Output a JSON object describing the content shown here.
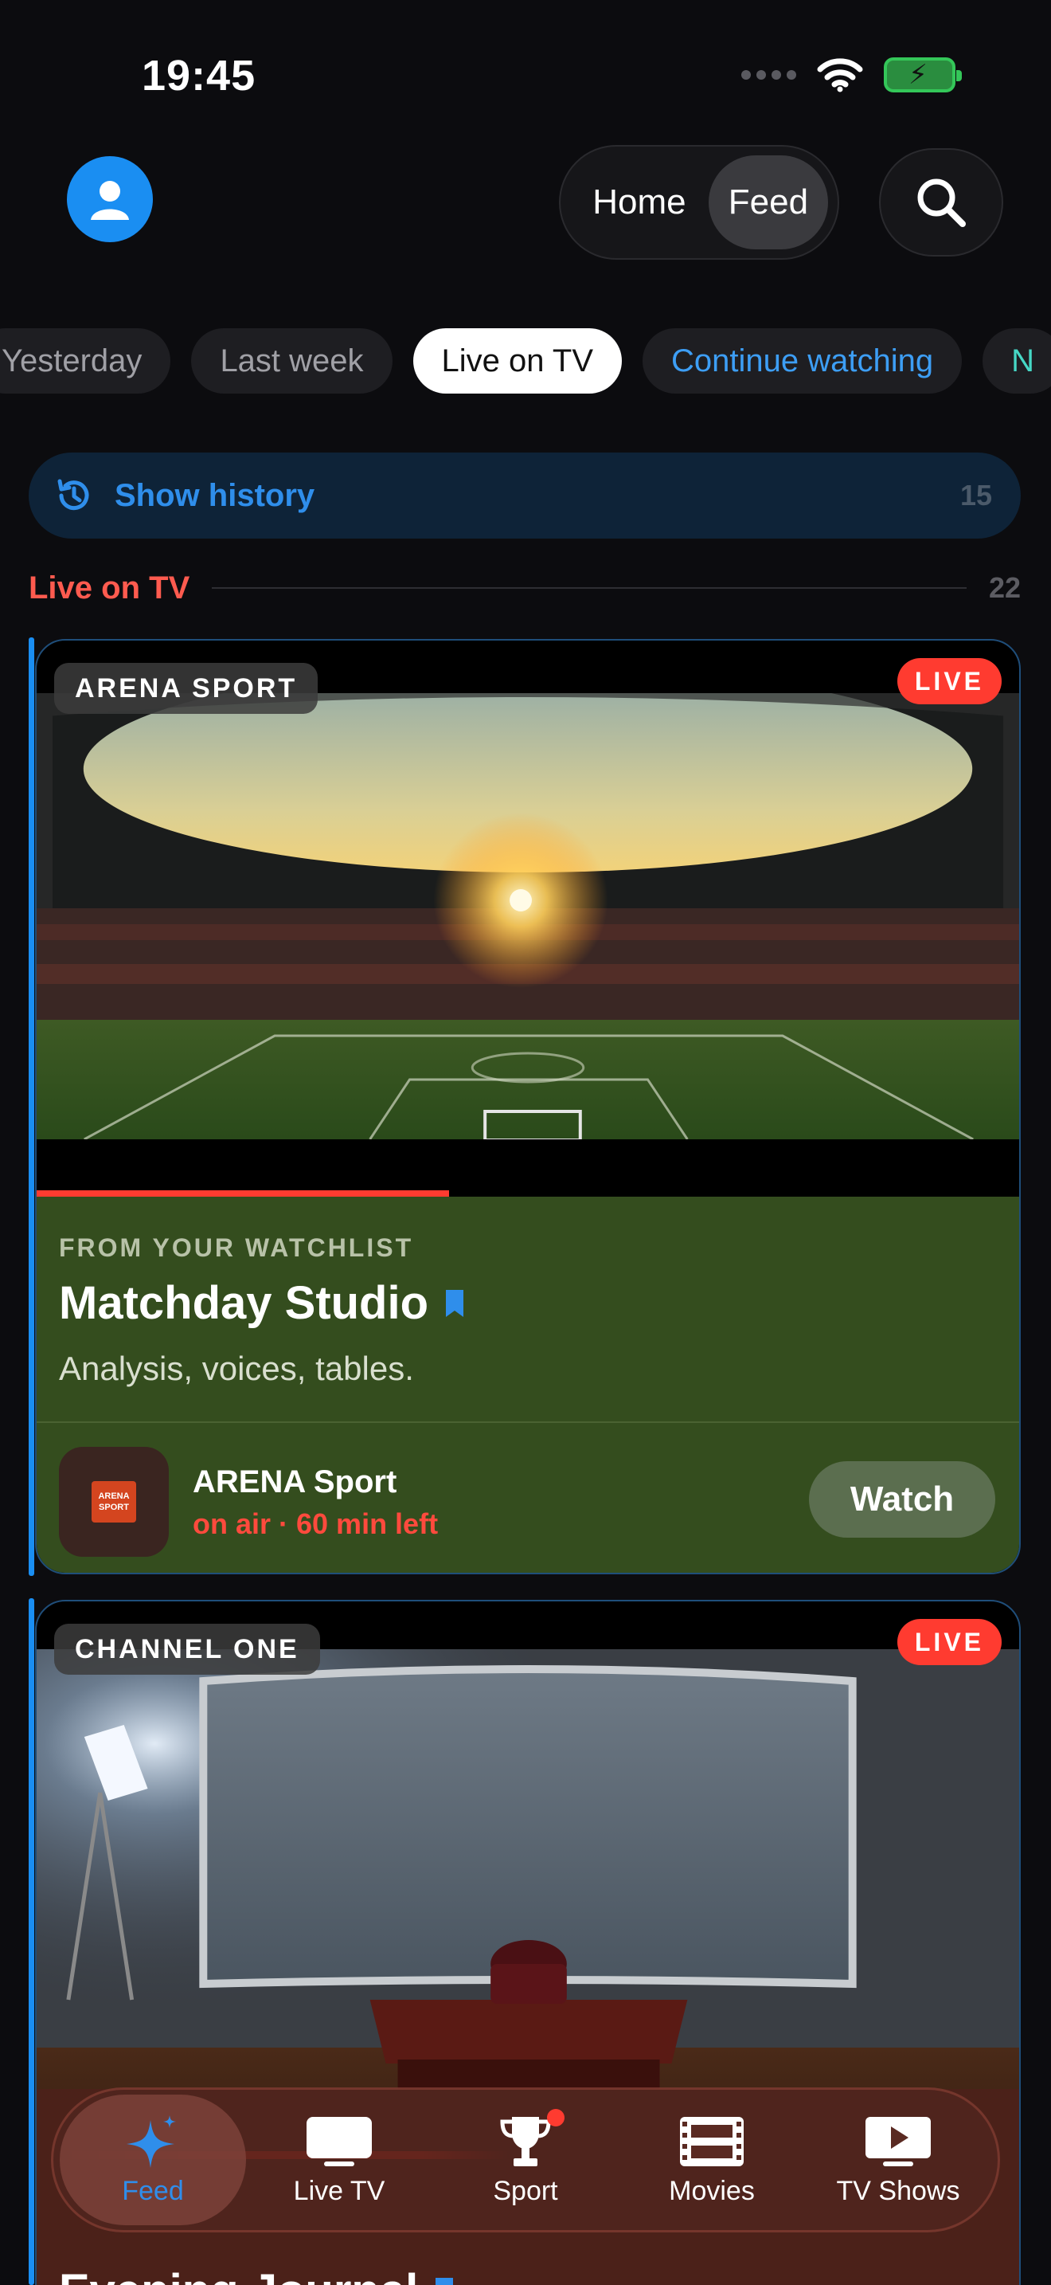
{
  "status_bar": {
    "time": "19:45"
  },
  "header": {
    "segments": [
      "Home",
      "Feed"
    ],
    "selected_segment": "Feed"
  },
  "filters": {
    "chips": [
      "Yesterday",
      "Last week",
      "Live on TV",
      "Continue watching",
      "N"
    ],
    "selected": "Live on TV"
  },
  "history": {
    "label": "Show history",
    "count": "15"
  },
  "section": {
    "label": "Live on TV",
    "count": "22"
  },
  "cards": [
    {
      "channel_badge": "ARENA SPORT",
      "live_label": "LIVE",
      "progress": 0.42,
      "kicker": "FROM YOUR WATCHLIST",
      "title": "Matchday Studio",
      "subtitle": "Analysis, voices, tables.",
      "channel_name": "ARENA Sport",
      "status": "on air · 60 min left",
      "logo_text": [
        "ARENA",
        "SPORT"
      ],
      "watch_label": "Watch"
    },
    {
      "channel_badge": "CHANNEL ONE",
      "live_label": "LIVE",
      "title": "Evening Journal"
    }
  ],
  "tabbar": {
    "tabs": [
      {
        "label": "Feed",
        "icon": "sparkle-icon"
      },
      {
        "label": "Live TV",
        "icon": "tv-icon"
      },
      {
        "label": "Sport",
        "icon": "trophy-icon"
      },
      {
        "label": "Movies",
        "icon": "film-icon"
      },
      {
        "label": "TV Shows",
        "icon": "play-icon"
      }
    ],
    "selected": "Feed"
  },
  "colors": {
    "accent": "#1a8ef2",
    "live": "#ff3b30",
    "card_body": "#344d1e",
    "history_bg": "#0e2338"
  }
}
